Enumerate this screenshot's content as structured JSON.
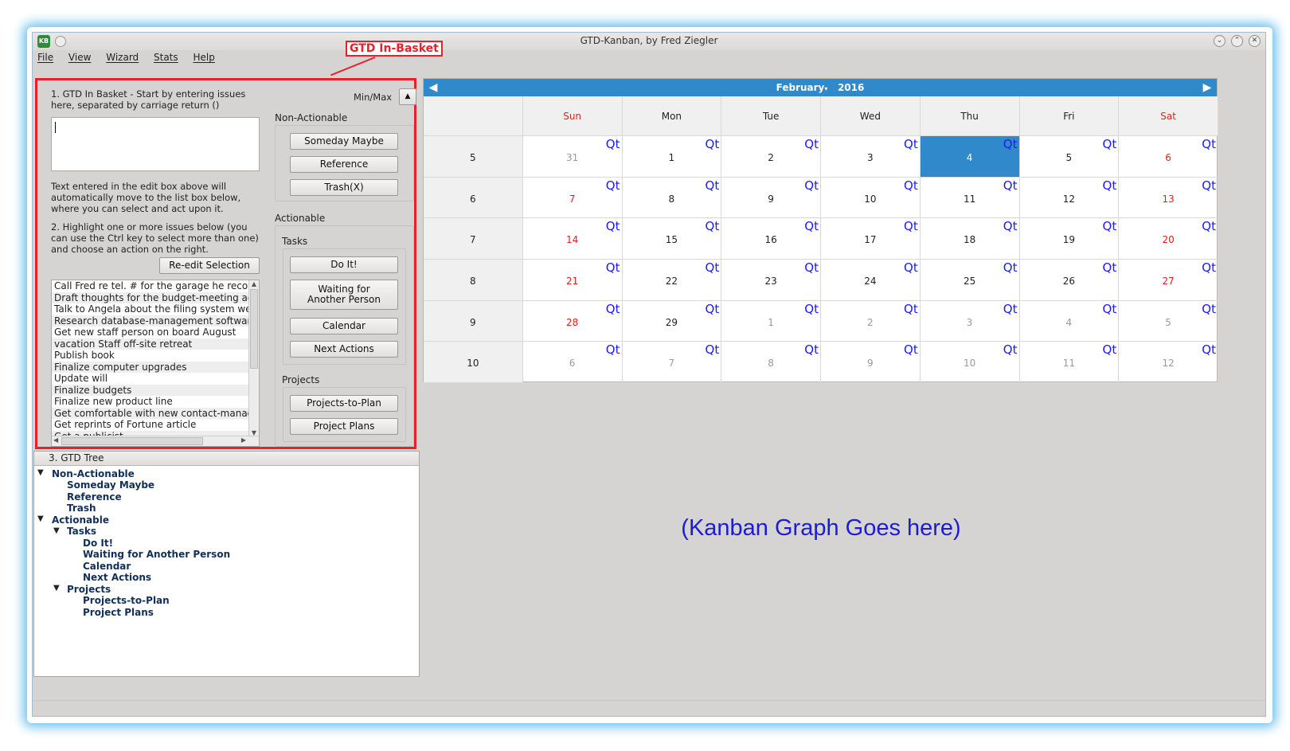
{
  "window": {
    "title": "GTD-Kanban, by Fred Ziegler",
    "app_icon": "KB"
  },
  "menu": [
    "File",
    "View",
    "Wizard",
    "Stats",
    "Help"
  ],
  "callout": "GTD In-Basket",
  "in_basket": {
    "instruction1": "1. GTD In Basket - Start by entering issues here, separated by carriage return ()",
    "minmax_label": "Min/Max",
    "auto_note": "Text entered in the edit box above will automatically move to the list box below, where you can select and act upon it.",
    "instruction2": "2. Highlight one or more issues below (you can use the Ctrl key to select more than one) and choose an action on the right.",
    "reedit_label": "Re-edit Selection",
    "items": [
      "Call Fred re tel. # for the garage he recommended",
      "Draft thoughts for the budget-meeting agenda",
      "Talk to Angela about the filing system we need",
      "Research database-management software on the web",
      "Get new staff person on board August",
      "vacation Staff off-site retreat",
      "Publish book",
      "Finalize computer upgrades",
      "Update will",
      "Finalize budgets",
      "Finalize new product line",
      "Get comfortable with new contact-management software",
      "Get reprints of Fortune article",
      "Get a publicist"
    ]
  },
  "actions": {
    "non_actionable_label": "Non-Actionable",
    "someday": "Someday Maybe",
    "reference": "Reference",
    "trash": "Trash(X)",
    "actionable_label": "Actionable",
    "tasks_label": "Tasks",
    "do_it": "Do It!",
    "waiting_line1": "Waiting for",
    "waiting_line2": "Another Person",
    "calendar": "Calendar",
    "next_actions": "Next Actions",
    "projects_label": "Projects",
    "projects_to_plan": "Projects-to-Plan",
    "project_plans": "Project Plans"
  },
  "tree": {
    "header": "3. GTD Tree",
    "nodes": [
      "Non-Actionable",
      "Someday Maybe",
      "Reference",
      "Trash",
      "Actionable",
      "Tasks",
      "Do It!",
      "Waiting for Another Person",
      "Calendar",
      "Next Actions",
      "Projects",
      "Projects-to-Plan",
      "Project Plans"
    ]
  },
  "calendar": {
    "month": "February",
    "year": "2016",
    "days": [
      "Sun",
      "Mon",
      "Tue",
      "Wed",
      "Thu",
      "Fri",
      "Sat"
    ],
    "cell_label": "Qt",
    "weeks": [
      {
        "num": "5",
        "dates": [
          "31",
          "1",
          "2",
          "3",
          "4",
          "5",
          "6"
        ]
      },
      {
        "num": "6",
        "dates": [
          "7",
          "8",
          "9",
          "10",
          "11",
          "12",
          "13"
        ]
      },
      {
        "num": "7",
        "dates": [
          "14",
          "15",
          "16",
          "17",
          "18",
          "19",
          "20"
        ]
      },
      {
        "num": "8",
        "dates": [
          "21",
          "22",
          "23",
          "24",
          "25",
          "26",
          "27"
        ]
      },
      {
        "num": "9",
        "dates": [
          "28",
          "29",
          "1",
          "2",
          "3",
          "4",
          "5"
        ]
      },
      {
        "num": "10",
        "dates": [
          "6",
          "7",
          "8",
          "9",
          "10",
          "11",
          "12"
        ]
      }
    ],
    "selected_date": "4",
    "weekend_color": "#e02020",
    "accent": "#2f89ca"
  },
  "kanban_placeholder": "(Kanban Graph Goes here)"
}
